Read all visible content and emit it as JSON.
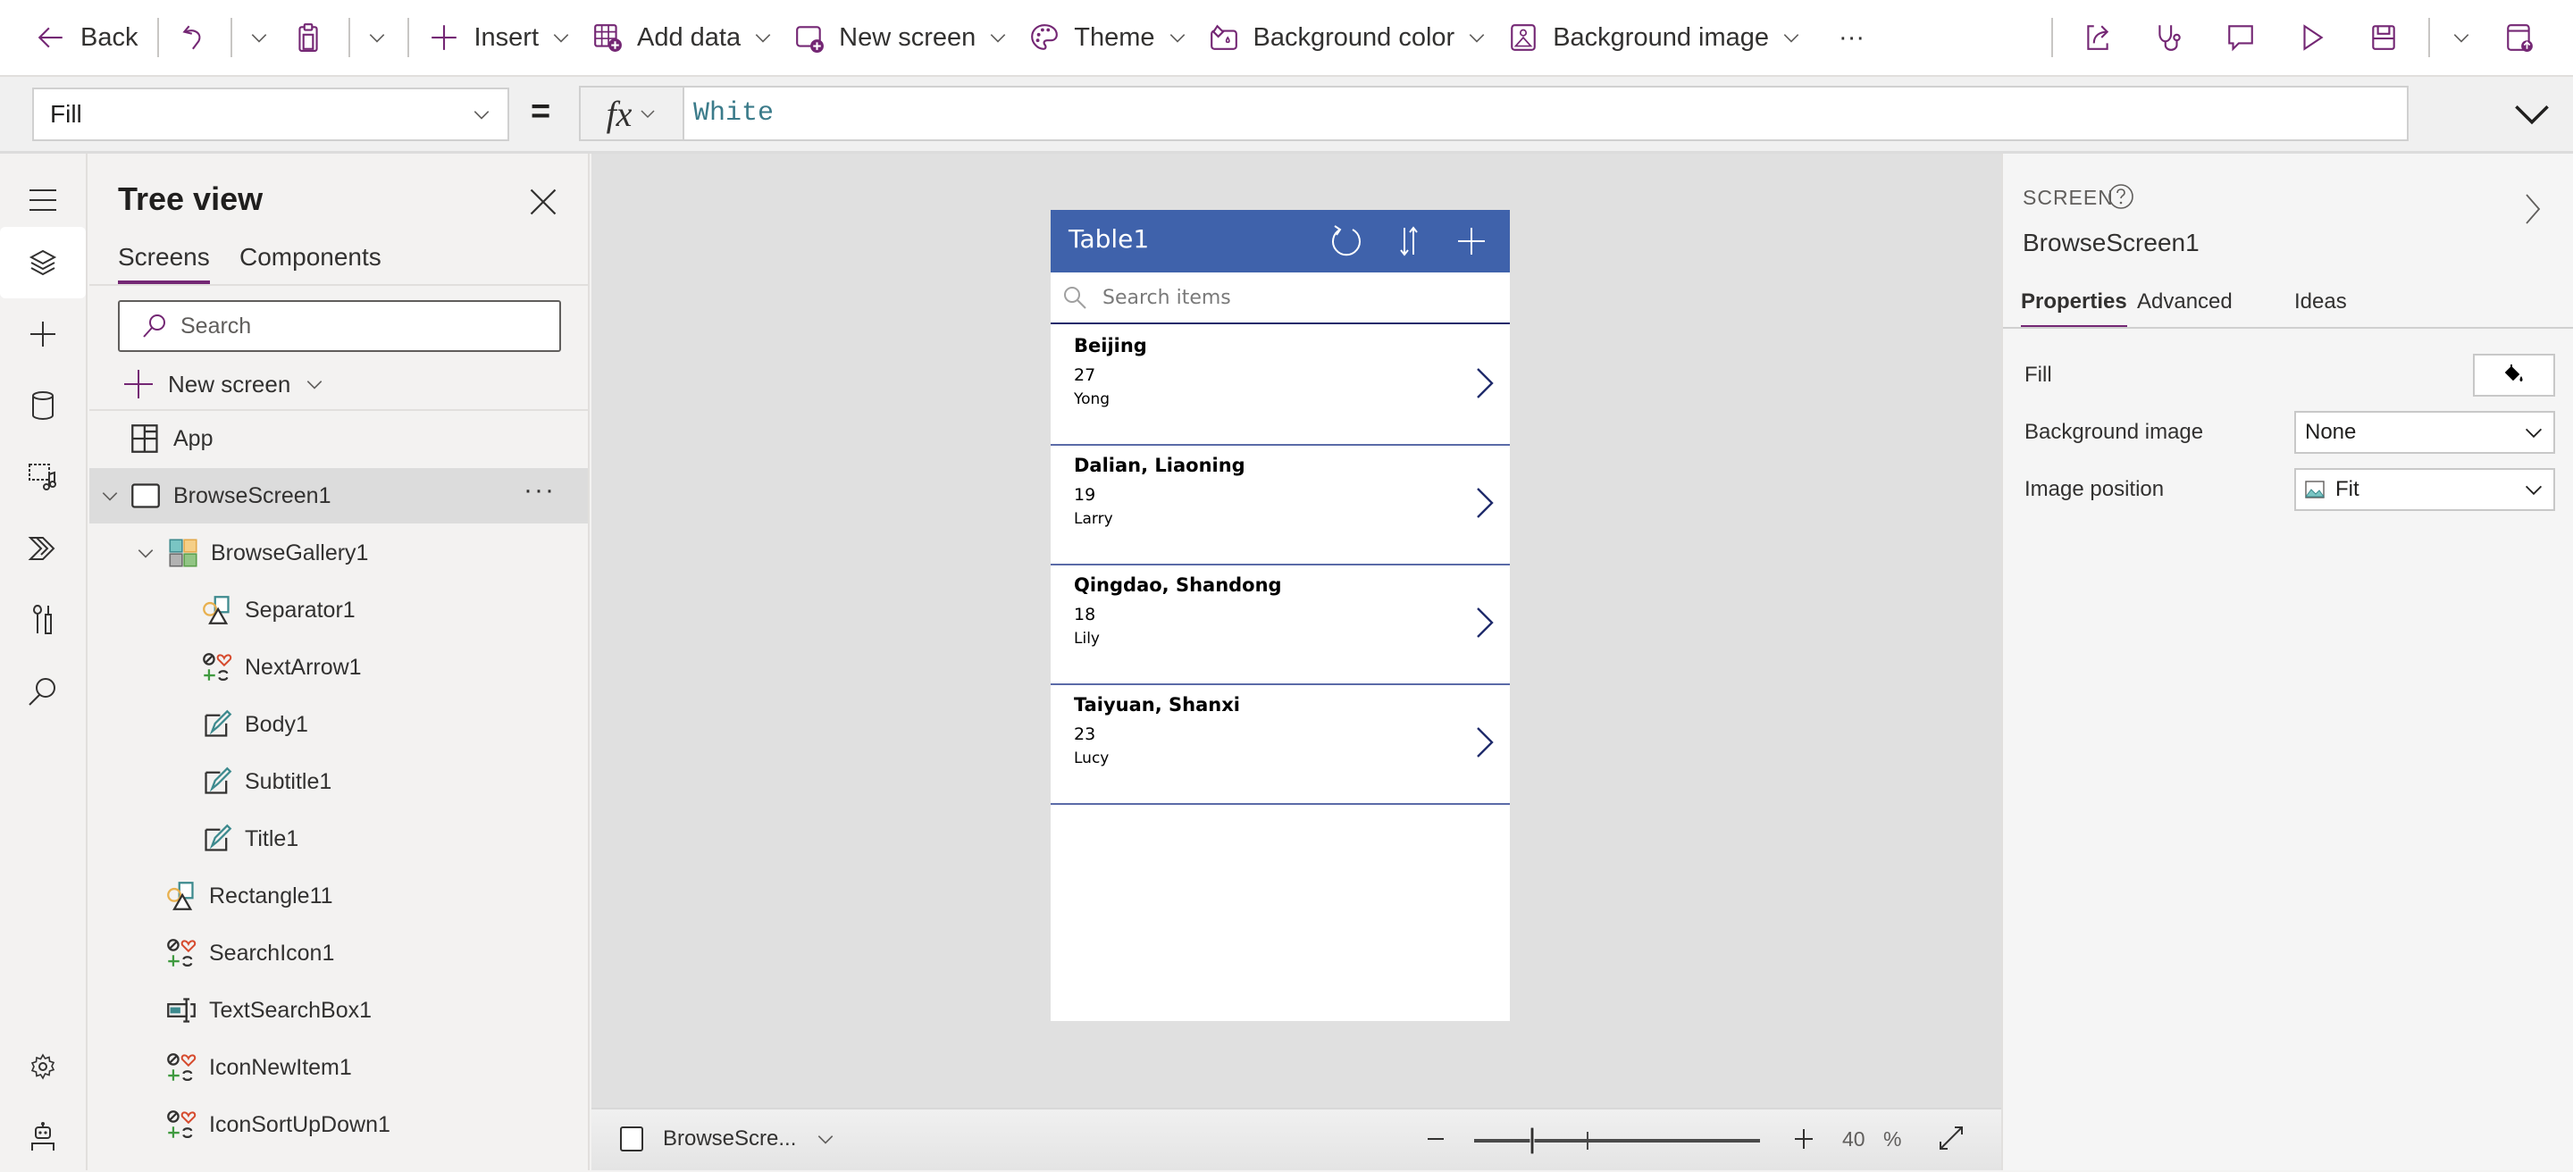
{
  "toolbar": {
    "back_label": "Back",
    "insert_label": "Insert",
    "add_data_label": "Add data",
    "new_screen_label": "New screen",
    "theme_label": "Theme",
    "background_color_label": "Background color",
    "background_image_label": "Background image",
    "more_label": "···",
    "accent_color": "#742774"
  },
  "formula_bar": {
    "property": "Fill",
    "equals": "=",
    "fx_label": "fx",
    "formula": "White"
  },
  "left_rail": {
    "items": [
      "menu",
      "tree-view",
      "insert",
      "data",
      "media",
      "power-automate",
      "advanced-tools",
      "search",
      "settings",
      "virtual-agent"
    ],
    "active": "tree-view"
  },
  "tree_view": {
    "title": "Tree view",
    "tabs": [
      {
        "label": "Screens",
        "active": true
      },
      {
        "label": "Components",
        "active": false
      }
    ],
    "search_placeholder": "Search",
    "new_screen_label": "New screen",
    "more_label": "···",
    "items": [
      {
        "label": "App",
        "icon": "app-icon",
        "level": 0,
        "expanded": null,
        "selected": false
      },
      {
        "label": "BrowseScreen1",
        "icon": "screen-icon",
        "level": 0,
        "expanded": true,
        "selected": true
      },
      {
        "label": "BrowseGallery1",
        "icon": "gallery-icon",
        "level": 1,
        "expanded": true,
        "selected": false
      },
      {
        "label": "Separator1",
        "icon": "shapes-icon",
        "level": 2,
        "expanded": null,
        "selected": false
      },
      {
        "label": "NextArrow1",
        "icon": "icons-icon",
        "level": 2,
        "expanded": null,
        "selected": false
      },
      {
        "label": "Body1",
        "icon": "label-icon",
        "level": 2,
        "expanded": null,
        "selected": false
      },
      {
        "label": "Subtitle1",
        "icon": "label-icon",
        "level": 2,
        "expanded": null,
        "selected": false
      },
      {
        "label": "Title1",
        "icon": "label-icon",
        "level": 2,
        "expanded": null,
        "selected": false
      },
      {
        "label": "Rectangle11",
        "icon": "shapes-icon",
        "level": 1,
        "expanded": null,
        "selected": false
      },
      {
        "label": "SearchIcon1",
        "icon": "icons-icon",
        "level": 1,
        "expanded": null,
        "selected": false
      },
      {
        "label": "TextSearchBox1",
        "icon": "textinput-icon",
        "level": 1,
        "expanded": null,
        "selected": false
      },
      {
        "label": "IconNewItem1",
        "icon": "icons-icon",
        "level": 1,
        "expanded": null,
        "selected": false
      },
      {
        "label": "IconSortUpDown1",
        "icon": "icons-icon",
        "level": 1,
        "expanded": null,
        "selected": false
      }
    ]
  },
  "app_preview": {
    "header_title": "Table1",
    "header_color": "#3f62ab",
    "search_placeholder": "Search items",
    "items": [
      {
        "title": "Beijing",
        "subtitle": "27",
        "body": "Yong"
      },
      {
        "title": "Dalian, Liaoning",
        "subtitle": "19",
        "body": "Larry"
      },
      {
        "title": "Qingdao, Shandong",
        "subtitle": "18",
        "body": "Lily"
      },
      {
        "title": "Taiyuan, Shanxi",
        "subtitle": "23",
        "body": "Lucy"
      }
    ]
  },
  "bottom_bar": {
    "screen_name": "BrowseScre...",
    "zoom_value": "40",
    "zoom_unit": "%",
    "zoom_slider_fraction": 0.2
  },
  "properties_panel": {
    "type_label": "SCREEN",
    "name": "BrowseScreen1",
    "tabs": [
      {
        "label": "Properties",
        "active": true
      },
      {
        "label": "Advanced",
        "active": false
      },
      {
        "label": "Ideas",
        "active": false
      }
    ],
    "fill_label": "Fill",
    "fill_value": "#ffffff",
    "background_image_label": "Background image",
    "background_image_value": "None",
    "image_position_label": "Image position",
    "image_position_value": "Fit"
  }
}
